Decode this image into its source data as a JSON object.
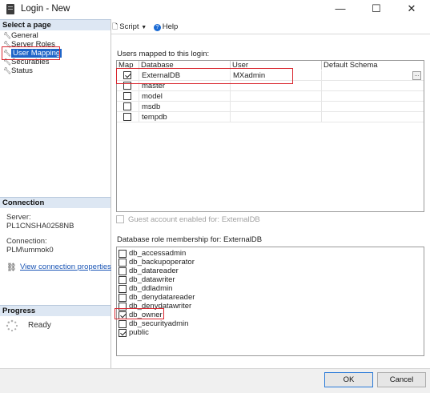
{
  "window": {
    "title": "Login - New",
    "minimize": "—",
    "maximize": "☐",
    "close": "✕"
  },
  "left_pane": {
    "select_page_header": "Select a page",
    "pages": [
      {
        "label": "General",
        "icon": "wrench-icon"
      },
      {
        "label": "Server Roles",
        "icon": "wrench-icon"
      },
      {
        "label": "User Mapping",
        "icon": "wrench-icon",
        "selected": true
      },
      {
        "label": "Securables",
        "icon": "wrench-icon"
      },
      {
        "label": "Status",
        "icon": "wrench-icon"
      }
    ],
    "connection_header": "Connection",
    "server_label": "Server:",
    "server_value": "PL1CNSHA0258NB",
    "connection_label": "Connection:",
    "connection_value": "PLM\\ummok0",
    "view_connection_link": "View connection properties",
    "progress_header": "Progress",
    "progress_status": "Ready"
  },
  "toolbar": {
    "script_label": "Script",
    "help_label": "Help"
  },
  "users_mapped": {
    "title": "Users mapped to this login:",
    "columns": [
      "Map",
      "Database",
      "User",
      "Default Schema"
    ],
    "rows": [
      {
        "map": true,
        "database": "ExternalDB",
        "user": "MXadmin",
        "schema": "",
        "ellipsis": "..."
      },
      {
        "map": false,
        "database": "master",
        "user": "",
        "schema": ""
      },
      {
        "map": false,
        "database": "model",
        "user": "",
        "schema": ""
      },
      {
        "map": false,
        "database": "msdb",
        "user": "",
        "schema": ""
      },
      {
        "map": false,
        "database": "tempdb",
        "user": "",
        "schema": ""
      }
    ]
  },
  "guest_account": {
    "label": "Guest account enabled for: ExternalDB",
    "checked": false
  },
  "role_membership": {
    "title": "Database role membership for: ExternalDB",
    "roles": [
      {
        "name": "db_accessadmin",
        "checked": false
      },
      {
        "name": "db_backupoperator",
        "checked": false
      },
      {
        "name": "db_datareader",
        "checked": false
      },
      {
        "name": "db_datawriter",
        "checked": false
      },
      {
        "name": "db_ddladmin",
        "checked": false
      },
      {
        "name": "db_denydatareader",
        "checked": false
      },
      {
        "name": "db_denydatawriter",
        "checked": false
      },
      {
        "name": "db_owner",
        "checked": true
      },
      {
        "name": "db_securityadmin",
        "checked": false
      },
      {
        "name": "public",
        "checked": true
      }
    ]
  },
  "buttons": {
    "ok": "OK",
    "cancel": "Cancel"
  },
  "colors": {
    "selection": "#1e64c8",
    "section_header": "#dde7f3",
    "highlight_box": "#d9262e",
    "link": "#1a55b5"
  }
}
